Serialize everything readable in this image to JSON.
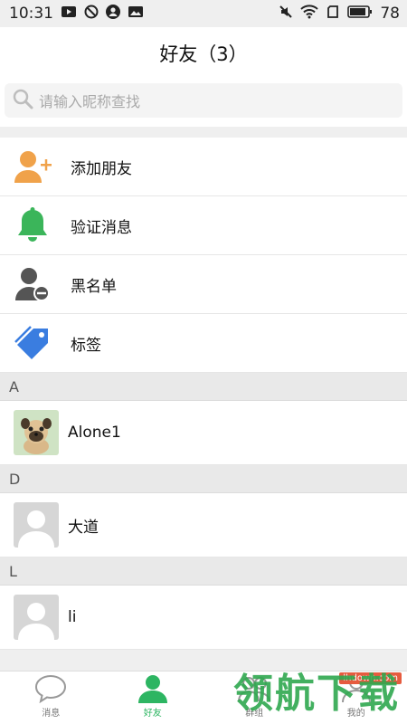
{
  "status_bar": {
    "time": "10:31",
    "battery": "78"
  },
  "header": {
    "title": "好友（3）"
  },
  "search": {
    "placeholder": "请输入昵称查找"
  },
  "menu": [
    {
      "label": "添加朋友",
      "icon": "add-friend-icon"
    },
    {
      "label": "验证消息",
      "icon": "bell-icon"
    },
    {
      "label": "黑名单",
      "icon": "blacklist-icon"
    },
    {
      "label": "标签",
      "icon": "tag-icon"
    }
  ],
  "sections": [
    {
      "letter": "A",
      "contacts": [
        {
          "name": "Alone1",
          "avatar": "pug-avatar"
        }
      ]
    },
    {
      "letter": "D",
      "contacts": [
        {
          "name": "大道",
          "avatar": "default-avatar"
        }
      ]
    },
    {
      "letter": "L",
      "contacts": [
        {
          "name": "li",
          "avatar": "default-avatar"
        }
      ]
    }
  ],
  "tabbar": [
    {
      "label": "消息",
      "icon": "chat-bubble-icon"
    },
    {
      "label": "好友",
      "icon": "person-icon"
    },
    {
      "label": "群组",
      "icon": "group-icon"
    },
    {
      "label": "我的",
      "icon": "profile-icon"
    }
  ],
  "watermark": {
    "text": "领航下载",
    "url": "lhdown.com"
  },
  "colors": {
    "accent": "#2db562",
    "add_icon": "#f0a24a",
    "bell_icon": "#3bb55a",
    "tag_icon": "#3a7de0"
  }
}
